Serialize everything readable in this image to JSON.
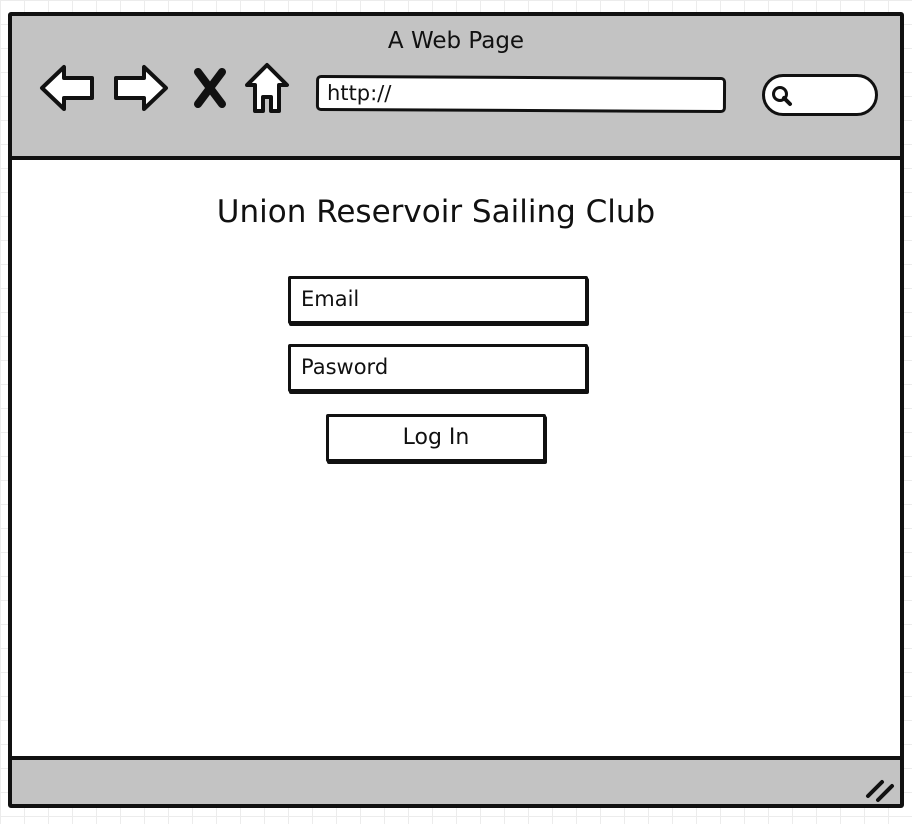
{
  "window": {
    "title": "A Web Page"
  },
  "toolbar": {
    "icons": [
      "back-arrow-icon",
      "forward-arrow-icon",
      "close-x-icon",
      "home-icon"
    ],
    "url_value": "http://",
    "search_icon": "search-icon"
  },
  "page": {
    "heading": "Union Reservoir Sailing Club",
    "email_placeholder": "Email",
    "password_placeholder": "Pasword",
    "login_label": "Log In"
  },
  "colors": {
    "chrome_gray": "#c3c3c3",
    "ink": "#111111",
    "background": "#ffffff"
  }
}
